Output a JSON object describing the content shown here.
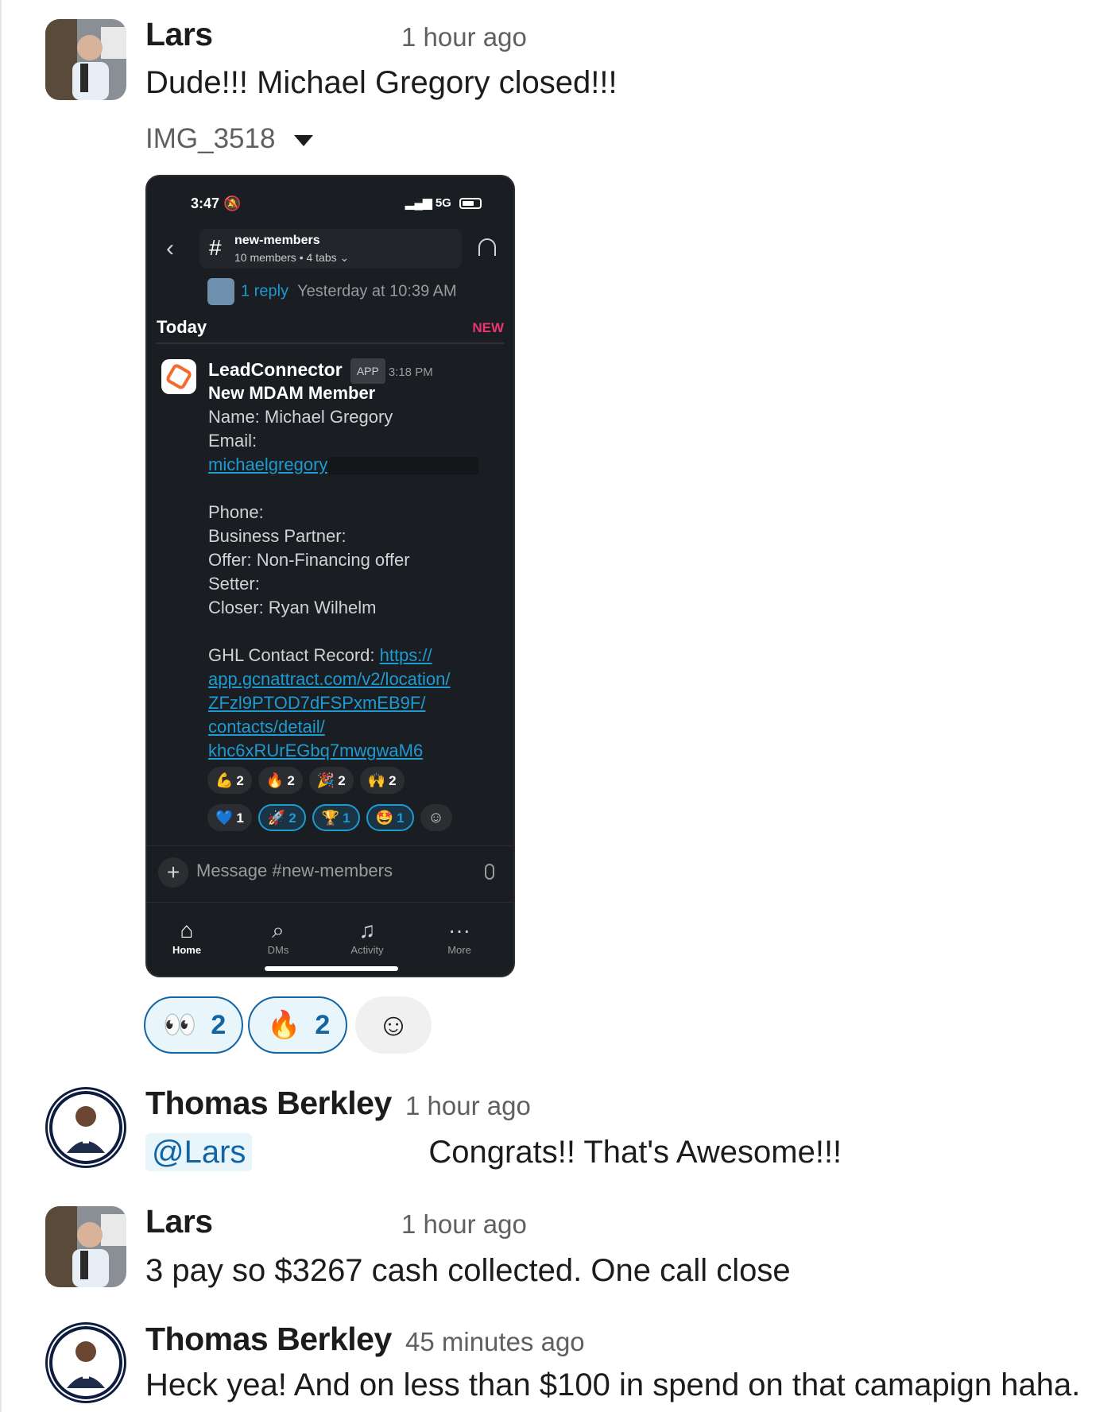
{
  "messages": [
    {
      "author": "Lars",
      "time": "1 hour ago",
      "text": "Dude!!! Michael Gregory closed!!!",
      "attachment": {
        "file_name": "IMG_3518",
        "screenshot": {
          "status_time": "3:47",
          "network": "5G",
          "channel_name": "new-members",
          "channel_sub": "10 members • 4 tabs",
          "reply_link": "1 reply",
          "reply_time": "Yesterday at 10:39 AM",
          "today_label": "Today",
          "new_label": "NEW",
          "sender": "LeadConnector",
          "app_badge": "APP",
          "msg_time": "3:18 PM",
          "title": "New MDAM Member",
          "name_line": "Name: Michael Gregory",
          "email_label": "Email:",
          "email_link": "michaelgregory",
          "phone_label": "Phone:",
          "partner_label": "Business Partner:",
          "offer_line": "Offer:  Non-Financing offer",
          "setter_label": "Setter:",
          "closer_line": "Closer:  Ryan Wilhelm",
          "ghl_label": "GHL Contact Record: ",
          "ghl_link_1": "https://",
          "ghl_link_2": "app.gcnattract.com/v2/location/",
          "ghl_link_3": "ZFzl9PTOD7dFSPxmEB9F/",
          "ghl_link_4": "contacts/detail/",
          "ghl_link_5": "khc6xRUrEGbq7mwgwaM6",
          "reactions_row1": [
            {
              "emoji": "💪",
              "count": "2"
            },
            {
              "emoji": "🔥",
              "count": "2"
            },
            {
              "emoji": "🎉",
              "count": "2"
            },
            {
              "emoji": "🙌",
              "count": "2"
            }
          ],
          "reactions_row2": [
            {
              "emoji": "💙",
              "count": "1"
            },
            {
              "emoji": "🚀",
              "count": "2"
            },
            {
              "emoji": "🏆",
              "count": "1"
            },
            {
              "emoji": "🤩",
              "count": "1"
            }
          ],
          "composer_placeholder": "Message #new-members",
          "tabs": [
            "Home",
            "DMs",
            "Activity",
            "More"
          ]
        }
      },
      "reactions": [
        {
          "emoji": "👀",
          "count": "2"
        },
        {
          "emoji": "🔥",
          "count": "2"
        }
      ]
    },
    {
      "author": "Thomas Berkley",
      "time": "1 hour ago",
      "mention": "@Lars",
      "text": "Congrats!! That's Awesome!!!"
    },
    {
      "author": "Lars",
      "time": "1 hour ago",
      "text": "3 pay so $3267 cash collected. One call close"
    },
    {
      "author": "Thomas Berkley",
      "time": "45 minutes ago",
      "text": "Heck yea! And on less than $100 in spend on that camapign haha."
    }
  ],
  "icons": {
    "add_reaction": "smiley-plus-icon",
    "dropdown": "caret-down-icon"
  }
}
